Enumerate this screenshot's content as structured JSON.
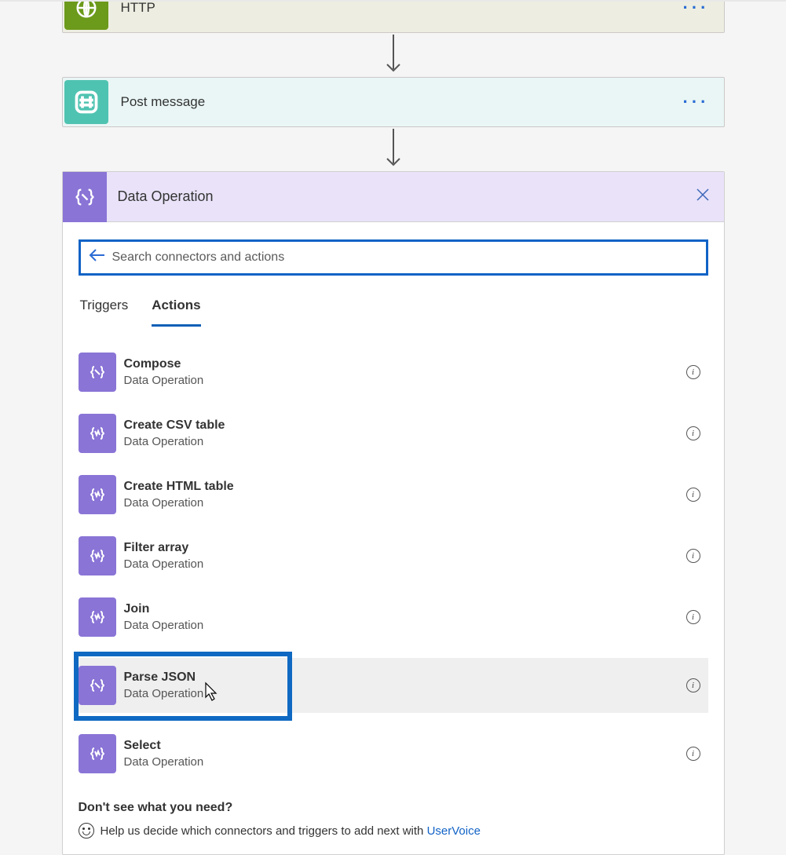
{
  "steps": {
    "http": {
      "title": "HTTP"
    },
    "post_message": {
      "title": "Post message"
    }
  },
  "panel": {
    "title": "Data Operation",
    "search_placeholder": "Search connectors and actions",
    "tabs": {
      "triggers": "Triggers",
      "actions": "Actions"
    },
    "actions": [
      {
        "name": "Compose",
        "sub": "Data Operation"
      },
      {
        "name": "Create CSV table",
        "sub": "Data Operation"
      },
      {
        "name": "Create HTML table",
        "sub": "Data Operation"
      },
      {
        "name": "Filter array",
        "sub": "Data Operation"
      },
      {
        "name": "Join",
        "sub": "Data Operation"
      },
      {
        "name": "Parse JSON",
        "sub": "Data Operation"
      },
      {
        "name": "Select",
        "sub": "Data Operation"
      }
    ],
    "footer": {
      "title": "Don't see what you need?",
      "help_prefix": "Help us decide which connectors and triggers to add next with ",
      "uservoice": "UserVoice"
    }
  }
}
